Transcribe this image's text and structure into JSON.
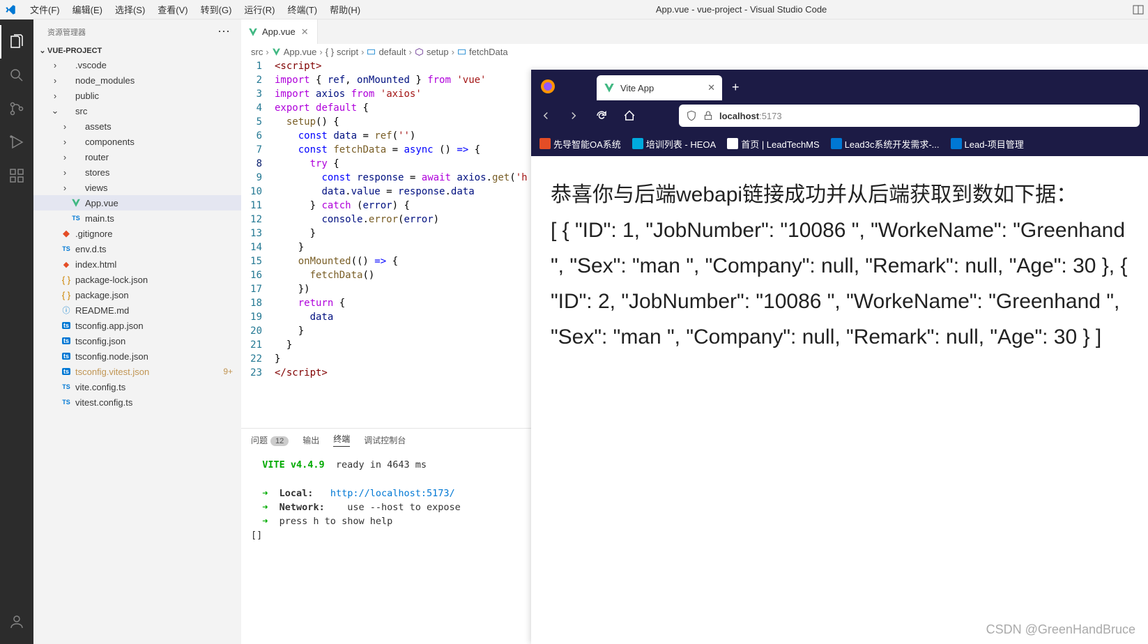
{
  "menubar": {
    "items": [
      "文件(F)",
      "编辑(E)",
      "选择(S)",
      "查看(V)",
      "转到(G)",
      "运行(R)",
      "终端(T)",
      "帮助(H)"
    ],
    "title": "App.vue - vue-project - Visual Studio Code"
  },
  "sidebar": {
    "title": "资源管理器",
    "project": "VUE-PROJECT",
    "tree": [
      {
        "label": ".vscode",
        "type": "folder",
        "indent": 1,
        "chev": "›"
      },
      {
        "label": "node_modules",
        "type": "folder",
        "indent": 1,
        "chev": "›"
      },
      {
        "label": "public",
        "type": "folder",
        "indent": 1,
        "chev": "›"
      },
      {
        "label": "src",
        "type": "folder",
        "indent": 1,
        "chev": "⌄"
      },
      {
        "label": "assets",
        "type": "folder",
        "indent": 2,
        "chev": "›"
      },
      {
        "label": "components",
        "type": "folder",
        "indent": 2,
        "chev": "›"
      },
      {
        "label": "router",
        "type": "folder",
        "indent": 2,
        "chev": "›"
      },
      {
        "label": "stores",
        "type": "folder",
        "indent": 2,
        "chev": "›"
      },
      {
        "label": "views",
        "type": "folder",
        "indent": 2,
        "chev": "›"
      },
      {
        "label": "App.vue",
        "type": "vue",
        "indent": 2,
        "chev": "",
        "active": true
      },
      {
        "label": "main.ts",
        "type": "ts",
        "indent": 2,
        "chev": ""
      },
      {
        "label": ".gitignore",
        "type": "git",
        "indent": 1,
        "chev": "",
        "mod": true
      },
      {
        "label": "env.d.ts",
        "type": "ts",
        "indent": 1,
        "chev": ""
      },
      {
        "label": "index.html",
        "type": "html",
        "indent": 1,
        "chev": ""
      },
      {
        "label": "package-lock.json",
        "type": "json",
        "indent": 1,
        "chev": ""
      },
      {
        "label": "package.json",
        "type": "json",
        "indent": 1,
        "chev": ""
      },
      {
        "label": "README.md",
        "type": "md",
        "indent": 1,
        "chev": ""
      },
      {
        "label": "tsconfig.app.json",
        "type": "tsc",
        "indent": 1,
        "chev": ""
      },
      {
        "label": "tsconfig.json",
        "type": "tsc",
        "indent": 1,
        "chev": ""
      },
      {
        "label": "tsconfig.node.json",
        "type": "tsc",
        "indent": 1,
        "chev": ""
      },
      {
        "label": "tsconfig.vitest.json",
        "type": "tsc",
        "indent": 1,
        "chev": "",
        "warn": true,
        "badge": "9+"
      },
      {
        "label": "vite.config.ts",
        "type": "ts",
        "indent": 1,
        "chev": ""
      },
      {
        "label": "vitest.config.ts",
        "type": "ts",
        "indent": 1,
        "chev": ""
      }
    ]
  },
  "tabs": [
    {
      "label": "App.vue"
    }
  ],
  "breadcrumb": [
    "src",
    "App.vue",
    "script",
    "default",
    "setup",
    "fetchData"
  ],
  "code": {
    "lines": [
      {
        "n": 1,
        "html": "<span class='k-tag'>&lt;script&gt;</span>"
      },
      {
        "n": 2,
        "html": "<span class='k-purple'>import</span> { <span class='k-dblue'>ref</span>, <span class='k-dblue'>onMounted</span> } <span class='k-purple'>from</span> <span class='k-str'>'vue'</span>"
      },
      {
        "n": 3,
        "html": "<span class='k-purple'>import</span> <span class='k-dblue'>axios</span> <span class='k-purple'>from</span> <span class='k-str'>'axios'</span>"
      },
      {
        "n": 4,
        "html": "<span class='k-purple'>export</span> <span class='k-purple'>default</span> {"
      },
      {
        "n": 5,
        "html": "  <span class='k-func'>setup</span>() {"
      },
      {
        "n": 6,
        "html": "    <span class='k-blue'>const</span> <span class='k-dblue'>data</span> = <span class='k-func'>ref</span>(<span class='k-str'>''</span>)"
      },
      {
        "n": 7,
        "html": "    <span class='k-blue'>const</span> <span class='k-func'>fetchData</span> = <span class='k-blue'>async</span> () <span class='k-blue'>=&gt;</span> {"
      },
      {
        "n": 8,
        "html": "      <span class='k-purple'>try</span> {",
        "cur": true
      },
      {
        "n": 9,
        "html": "        <span class='k-blue'>const</span> <span class='k-dblue'>response</span> = <span class='k-purple'>await</span> <span class='k-dblue'>axios</span>.<span class='k-func'>get</span>(<span class='k-str'>'h</span>"
      },
      {
        "n": 10,
        "html": "        <span class='k-dblue'>data</span>.<span class='k-dblue'>value</span> = <span class='k-dblue'>response</span>.<span class='k-dblue'>data</span>"
      },
      {
        "n": 11,
        "html": "      } <span class='k-purple'>catch</span> (<span class='k-dblue'>error</span>) {"
      },
      {
        "n": 12,
        "html": "        <span class='k-dblue'>console</span>.<span class='k-func'>error</span>(<span class='k-dblue'>error</span>)"
      },
      {
        "n": 13,
        "html": "      }"
      },
      {
        "n": 14,
        "html": "    }"
      },
      {
        "n": 15,
        "html": "    <span class='k-func'>onMounted</span>(() <span class='k-blue'>=&gt;</span> {"
      },
      {
        "n": 16,
        "html": "      <span class='k-func'>fetchData</span>()"
      },
      {
        "n": 17,
        "html": "    })"
      },
      {
        "n": 18,
        "html": "    <span class='k-purple'>return</span> {"
      },
      {
        "n": 19,
        "html": "      <span class='k-dblue'>data</span>"
      },
      {
        "n": 20,
        "html": "    }"
      },
      {
        "n": 21,
        "html": "  }"
      },
      {
        "n": 22,
        "html": "}"
      },
      {
        "n": 23,
        "html": "<span class='k-tag'>&lt;/script&gt;</span>"
      }
    ]
  },
  "panel": {
    "tabs": {
      "problems": "问题",
      "problems_count": "12",
      "output": "输出",
      "terminal": "终端",
      "debug": "调试控制台"
    },
    "terminal_vite": "VITE v4.4.9",
    "terminal_ready": "  ready in 4643 ms",
    "terminal_lines": [
      {
        "arrow": "➜",
        "label": "Local:",
        "url": "http://localhost:5173/"
      },
      {
        "arrow": "➜",
        "label": "Network:",
        "rest": " use --host to expose"
      },
      {
        "arrow": "➜",
        "rest": "press h to show help"
      }
    ],
    "terminal_prompt": "[]"
  },
  "browser": {
    "tab_title": "Vite App",
    "url_host": "localhost",
    "url_port": ":5173",
    "bookmarks": [
      "先导智能OA系统",
      "培训列表 - HEOA",
      "首页 | LeadTechMS",
      "Lead3c系统开发需求-...",
      "Lead-项目管理"
    ],
    "content_heading": "恭喜你与后端webapi链接成功并从后端获取到数如下据：",
    "content_data": "[ { \"ID\": 1, \"JobNumber\": \"10086 \", \"WorkeName\": \"Greenhand \", \"Sex\": \"man \", \"Company\": null, \"Remark\": null, \"Age\": 30 }, { \"ID\": 2, \"JobNumber\": \"10086 \", \"WorkeName\": \"Greenhand \", \"Sex\": \"man \", \"Company\": null, \"Remark\": null, \"Age\": 30 } ]"
  },
  "watermark": "CSDN @GreenHandBruce"
}
